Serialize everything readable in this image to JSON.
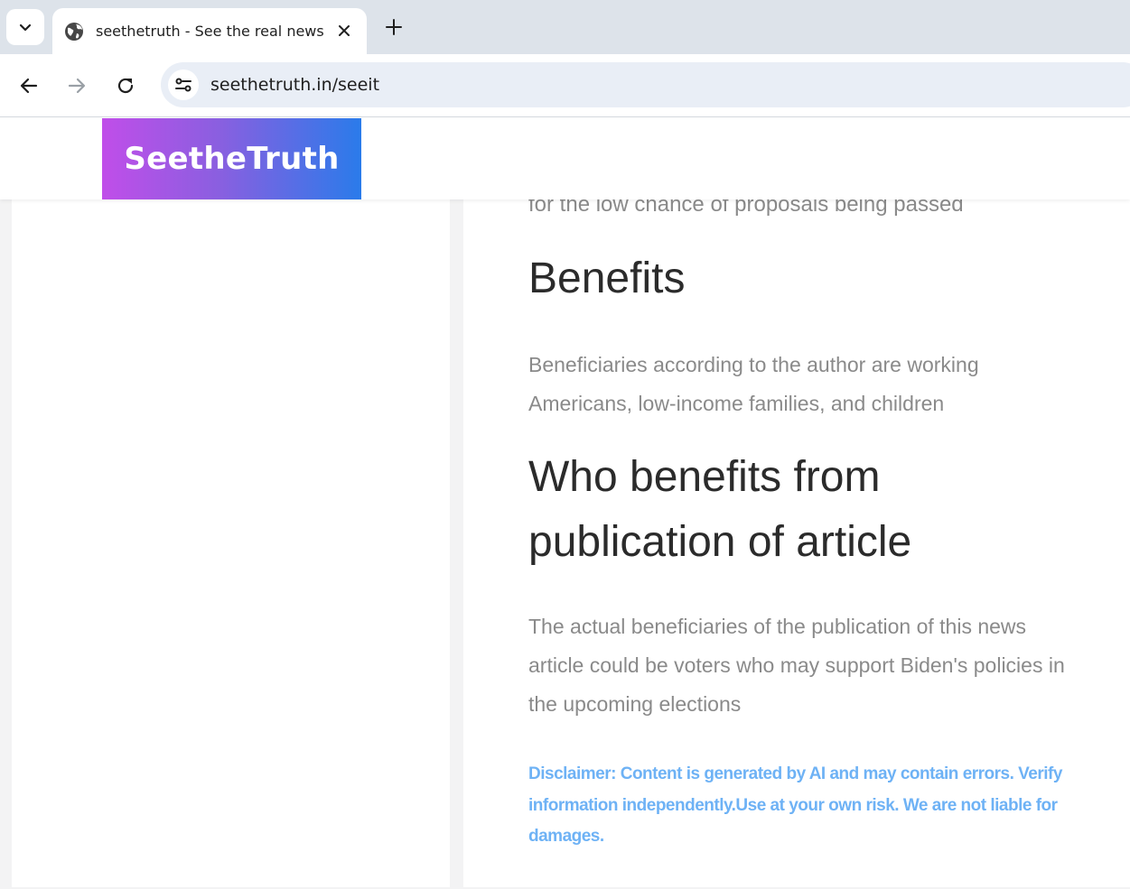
{
  "browser": {
    "tab_title": "seethetruth - See the real news",
    "url": "seethetruth.in/seeit"
  },
  "site": {
    "logo_text": "SeetheTruth"
  },
  "article": {
    "cut_off_text": "for the low chance of proposals being passed",
    "benefits_heading": "Benefits",
    "benefits_text": "Beneficiaries according to the author are working Americans, low-income families, and children",
    "who_heading": "Who benefits from publication of article",
    "who_text": "The actual beneficiaries of the publication of this news article could be voters who may support Biden's policies in the upcoming elections",
    "disclaimer": "Disclaimer: Content is generated by AI and may contain errors. Verify information independently.Use at your own risk. We are not liable for damages."
  },
  "colors": {
    "logo_gradient_start": "#c04ee9",
    "logo_gradient_end": "#2a7bea",
    "disclaimer": "#6eb2f5",
    "heading": "#2b2b2b",
    "body_text": "#8a8a8a"
  },
  "icons": [
    "chevron-down-icon",
    "globe-icon",
    "close-icon",
    "plus-icon",
    "back-arrow-icon",
    "forward-arrow-icon",
    "reload-icon",
    "site-settings-icon"
  ]
}
